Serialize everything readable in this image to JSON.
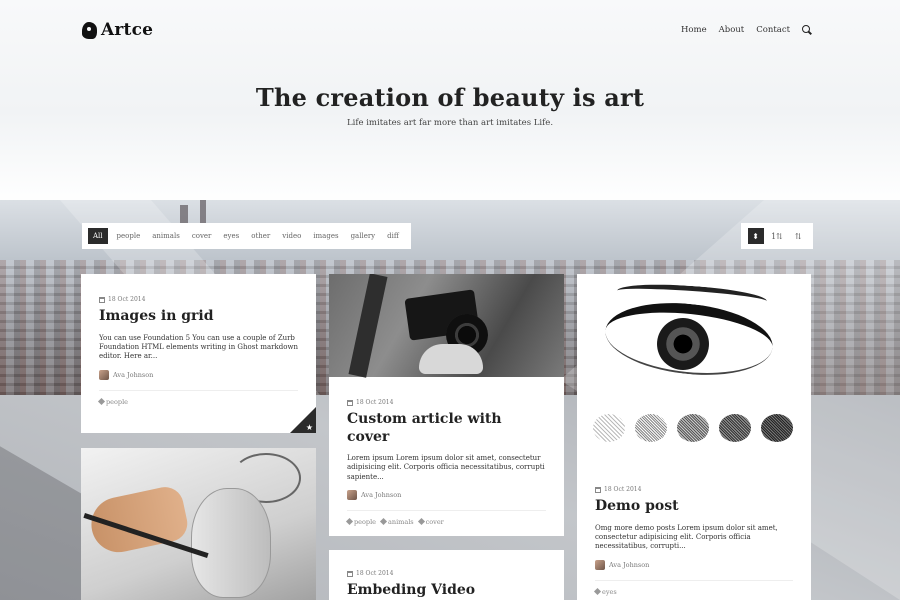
{
  "header": {
    "logo_text": "Artce",
    "nav": [
      "Home",
      "About",
      "Contact"
    ],
    "search_icon": "search-icon"
  },
  "hero": {
    "title": "The creation of beauty is art",
    "subtitle": "Life imitates art far more than art imitates Life."
  },
  "filters": {
    "tags": [
      "All",
      "people",
      "animals",
      "cover",
      "eyes",
      "other",
      "video",
      "images",
      "gallery",
      "diff"
    ],
    "active": "All"
  },
  "sort": {
    "buttons": [
      {
        "icon": "sort-icon",
        "glyph": "⬍",
        "active": true
      },
      {
        "icon": "sort-numeric-asc-icon",
        "glyph": "1⇅",
        "active": false
      },
      {
        "icon": "sort-numeric-desc-icon",
        "glyph": "⇅",
        "active": false
      }
    ]
  },
  "posts": [
    {
      "date": "18 Oct 2014",
      "title": "Images in grid",
      "excerpt": "You can use Foundation 5 You can use a couple of Zurb Foundation HTML elements writing in Ghost markdown editor. Here ar...",
      "author": "Ava Johnson",
      "tags": [
        "people"
      ],
      "featured": true
    },
    {
      "date": "18 Oct 2014",
      "title": "Custom article with cover",
      "excerpt": "Lorem ipsum Lorem ipsum dolor sit amet, consectetur adipisicing elit. Corporis officia necessitatibus, corrupti sapiente...",
      "author": "Ava Johnson",
      "tags": [
        "people",
        "animals",
        "cover"
      ]
    },
    {
      "date": "18 Oct 2014",
      "title": "Demo post",
      "excerpt": "Omg more demo posts Lorem ipsum dolor sit amet, consectetur adipisicing elit. Corporis officia necessitatibus, corrupti...",
      "author": "Ava Johnson",
      "tags": [
        "eyes"
      ]
    },
    {
      "date": "18 Oct 2014",
      "title": "Embeding Video"
    }
  ]
}
